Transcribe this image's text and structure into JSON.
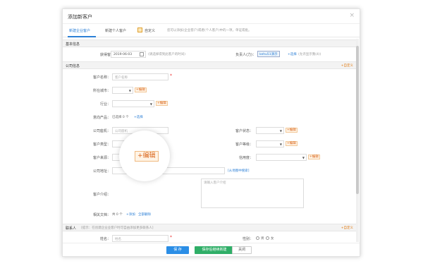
{
  "dialog": {
    "title": "添加新客户",
    "close_glyph": "×"
  },
  "tabs": {
    "items": [
      "新建企业客户",
      "新建个人客户",
      "自定义"
    ],
    "note": "您可以添加(企业客户)或者(个人客户)中的一项，单证或批。"
  },
  "sections": {
    "basic": "基本信息",
    "company": "公司信息",
    "contact": "联系人",
    "contact_tip": "[提示：在创建企业业客户时可自由添加更多联系人]",
    "custom_label": "+自定义"
  },
  "basic": {
    "time_label": "获得客户时间：",
    "time_value": "2019-06-03",
    "time_hint": "(请选择得到此客户的时间)",
    "owner_label": "负责人(力)：",
    "owner_value": "kehu51演示",
    "owner_select": "+选择",
    "owner_hint": "(允许显示我(4))"
  },
  "company": {
    "name_label": "客户名称：",
    "name_placeholder": "客户名称",
    "city_label": "所在城市：",
    "industry_label": "行业：",
    "product_label": "意向产品：",
    "product_value": "已选择 0 个",
    "product_select": "+选择",
    "phone_label": "公司座机：",
    "phone_placeholder": "公司座机",
    "status_label": "客户状态：",
    "type_label": "客户类型：",
    "level_label": "客户等级：",
    "source_label": "客户来源：",
    "fame_label": "信用度：",
    "address_label": "公司地址：",
    "address_link": "[从地图中搜索]",
    "intro_label": "客户介绍：",
    "intro_placeholder": "请输入客户介绍",
    "files_label": "相关文档：",
    "files_count": "共 0 个",
    "files_add": "+添加",
    "files_delete": "全部删除",
    "edit_label": "+编辑",
    "required_mark": "*"
  },
  "contact": {
    "name_label": "姓名：",
    "name_placeholder": "姓名",
    "gender_label": "性别：",
    "gender_options": [
      "男",
      "女"
    ]
  },
  "zoom": {
    "label": "+编辑"
  },
  "footer": {
    "save": "保 存",
    "save_new": "保存后继续新建",
    "close": "关闭"
  },
  "colors": {
    "accent": "#2b7fd6",
    "edit": "#d9641a",
    "save_green": "#2fae67"
  }
}
